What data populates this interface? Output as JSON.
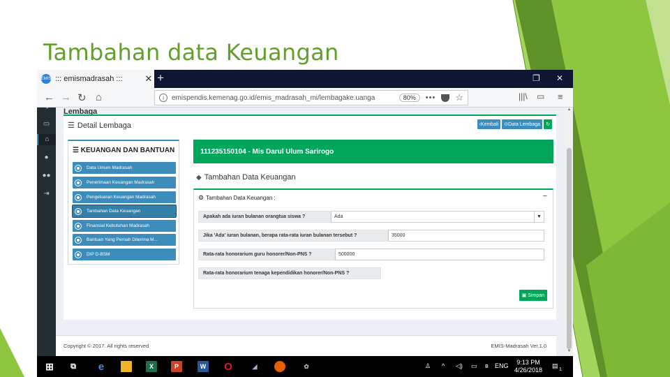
{
  "slide": {
    "title": "Tambahan data Keuangan",
    "colors": {
      "title": "#5fa12a",
      "accent_green": "#00a65a",
      "accent_blue": "#3c8dbc",
      "deco_dark": "#5e9228",
      "deco_light": "#8fc63f"
    }
  },
  "browser": {
    "tab_title": "::: emismadrasah :::",
    "tab_close_icon": "close-icon",
    "new_tab_icon": "plus-icon",
    "url": "emispendis.kemenag.go.id/emis_madrasah_mi/lembagake.uanga",
    "zoom": "80%",
    "more_label": "•••"
  },
  "app": {
    "partial_header": "Lembaga",
    "detail_title": "Detail Lembaga",
    "btn_kembali": "Kembali",
    "btn_data_lembaga": "Data Lembaga",
    "left_panel_title": "KEUANGAN DAN BANTUAN",
    "menu": [
      {
        "label": "Data Umum Madrasah"
      },
      {
        "label": "Penerimaan Keuangan Madrasah"
      },
      {
        "label": "Pengeluaran Keuangan Madrasah"
      },
      {
        "label": "Tambahan Data Keuangan",
        "active": true
      },
      {
        "label": "Finansial Kebutuhan Madrasah"
      },
      {
        "label": "Bantuan Yang Pernah Diterima M..."
      },
      {
        "label": "DIP D-BSM"
      }
    ],
    "school_banner": "111235150104 - Mis Darul Ulum Sarirogo",
    "section_title": "Tambahan Data Keuangan",
    "form_title": "Tambahan Data Keuangan :",
    "minimize_label": "−",
    "fields": [
      {
        "label": "Apakah ada iuran bulanan orangtua siswa ?",
        "value": "Ada",
        "type": "select"
      },
      {
        "label": "Jika 'Ada' iuran bulanan, berapa rata-rata iuran bulanan tersebut ?",
        "value": "35000",
        "type": "input"
      },
      {
        "label": "Rata-rata honorarium guru honorer/Non-PNS ?",
        "value": "500000",
        "type": "input"
      },
      {
        "label": "Rata-rata honorarium tenaga kependidikan honorer/Non-PNS ?",
        "value": "",
        "type": "input"
      }
    ],
    "save_label": "Simpan",
    "footer_copyright": "Copyright © 2017. All rights reserved",
    "footer_version": "EMIS-Madrasah Ver.1.0"
  },
  "taskbar": {
    "time": "9:13 PM",
    "date": "4/26/2018",
    "lang": "ENG",
    "notif_count": "1"
  }
}
